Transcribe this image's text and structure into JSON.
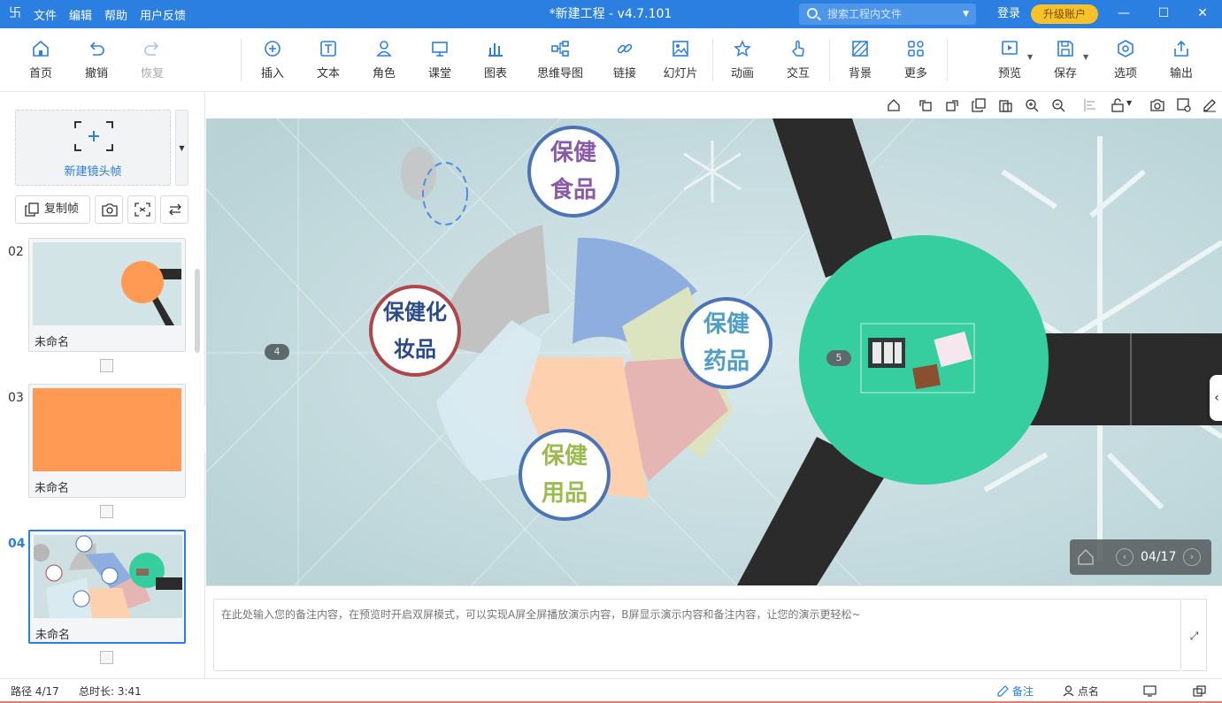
{
  "titlebar": {
    "logo": "卐",
    "menu": [
      "文件",
      "编辑",
      "帮助",
      "用户反馈"
    ],
    "title": "*新建工程 - v4.7.101",
    "search_placeholder": "搜索工程内文件",
    "login": "登录",
    "upgrade": "升级账户",
    "minimize": "—",
    "maximize": "☐",
    "close": "✕"
  },
  "toolbar": {
    "home": "首页",
    "undo": "撤销",
    "redo": "恢复",
    "insert": "插入",
    "text": "文本",
    "role": "角色",
    "classroom": "课堂",
    "chart": "图表",
    "mindmap": "思维导图",
    "link": "链接",
    "slideshow": "幻灯片",
    "animation": "动画",
    "interaction": "交互",
    "background": "背景",
    "more": "更多",
    "preview": "预览",
    "save": "保存",
    "options": "选项",
    "export": "输出"
  },
  "leftpanel": {
    "new_frame": "新建镜头帧",
    "copy_frame": "复制帧",
    "slides": [
      {
        "num": "02",
        "name": "未命名",
        "active": false
      },
      {
        "num": "03",
        "name": "未命名",
        "active": false
      },
      {
        "num": "04",
        "name": "未命名",
        "active": true
      }
    ]
  },
  "canvas": {
    "bubbles": {
      "food": "保健\n食品",
      "cosmetics": "保健化\n妆品",
      "medicine": "保健\n药品",
      "supplies": "保健\n用品"
    },
    "markers": {
      "left": "4",
      "right": "5"
    },
    "thumb_bubbles": {
      "food": "保健食品",
      "cosmetics": "保健化妆品",
      "medicine": "保健药品",
      "supplies": "保健用品"
    },
    "page_indicator": "04/17"
  },
  "notes": {
    "placeholder": "在此处输入您的备注内容，在预览时开启双屏模式，可以实现A屏全屏播放演示内容，B屏显示演示内容和备注内容，让您的演示更轻松~"
  },
  "status": {
    "path": "路径 4/17",
    "duration": "总时长: 3:41",
    "notes": "备注",
    "rollcall": "点名"
  },
  "colors": {
    "accent": "#2a7fe0",
    "green_circle": "#36ce9f",
    "orange": "#ff9a55",
    "upgrade": "#f7c12a"
  }
}
